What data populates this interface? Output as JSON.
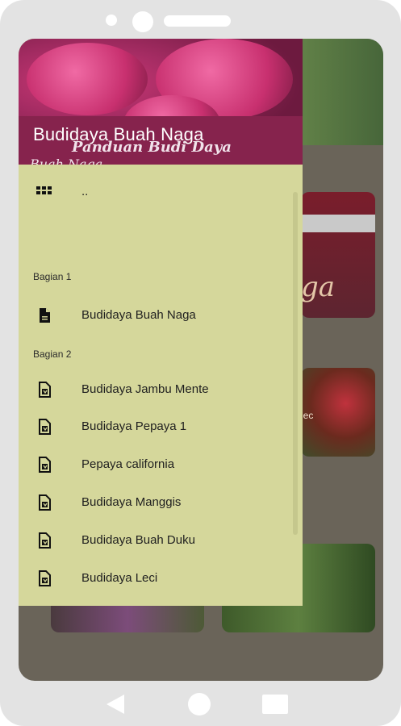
{
  "drawer": {
    "header": {
      "title": "Budidaya Buah Naga",
      "subtitle": "Panduan Budi Daya",
      "peek": "Buah Naga"
    },
    "top_item": {
      "icon": "grid-icon",
      "label": ".."
    },
    "sections": [
      {
        "title": "Bagian 1",
        "items": [
          {
            "icon": "file-icon",
            "label": "Budidaya Buah Naga"
          }
        ]
      },
      {
        "title": "Bagian 2",
        "items": [
          {
            "icon": "document-icon",
            "label": "Budidaya Jambu Mente"
          },
          {
            "icon": "document-icon",
            "label": "Budidaya Pepaya 1"
          },
          {
            "icon": "document-icon",
            "label": "Pepaya california"
          },
          {
            "icon": "document-icon",
            "label": "Budidaya Manggis"
          },
          {
            "icon": "document-icon",
            "label": "Budidaya Buah Duku"
          },
          {
            "icon": "document-icon",
            "label": "Budidaya Leci"
          }
        ]
      }
    ]
  },
  "background": {
    "card1_text": "ga",
    "card2_text": "lec"
  },
  "navbar": {
    "back_icon": "back-triangle-icon",
    "home_icon": "home-circle-icon",
    "recent_icon": "recent-square-icon"
  },
  "colors": {
    "drawer_bg": "#d5d79b",
    "header_accent": "#86234d",
    "phone_frame": "#e3e3e3"
  }
}
